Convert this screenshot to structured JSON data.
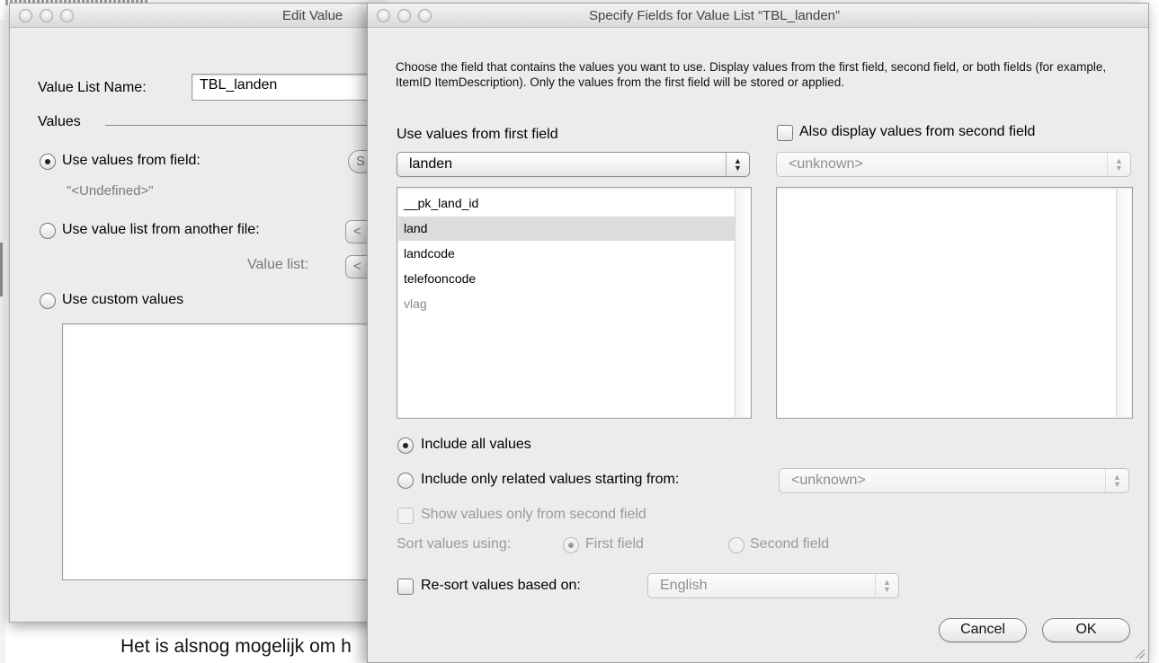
{
  "background": {
    "page_text": "Het is alsnog mogelijk om h"
  },
  "edit_window": {
    "title": "Edit Value",
    "name_label": "Value List Name:",
    "name_value": "TBL_landen",
    "values_heading": "Values",
    "options": {
      "from_field": {
        "label": "Use values from field:",
        "selected": true
      },
      "field_value": "\"<Undefined>\"",
      "from_file": {
        "label": "Use value list from another file:",
        "selected": false
      },
      "value_list_label": "Value list:",
      "custom": {
        "label": "Use custom values",
        "selected": false
      }
    },
    "specify_btn_stub": "S",
    "file_popup_stub": "<",
    "list_popup_stub": "<"
  },
  "spec_window": {
    "title": "Specify Fields for Value List “TBL_landen”",
    "description": "Choose the field that contains the values you want to use.  Display values from the first field, second field, or both fields (for example, ItemID ItemDescription). Only the values from the first field will be stored or applied.",
    "first_field": {
      "heading": "Use values from first field",
      "table": "landen",
      "fields": [
        {
          "name": "__pk_land_id",
          "selected": false,
          "enabled": true
        },
        {
          "name": "land",
          "selected": true,
          "enabled": true
        },
        {
          "name": "landcode",
          "selected": false,
          "enabled": true
        },
        {
          "name": "telefooncode",
          "selected": false,
          "enabled": true
        },
        {
          "name": "vlag",
          "selected": false,
          "enabled": false
        }
      ]
    },
    "second_field": {
      "checkbox_label": "Also display values from second field",
      "checked": false,
      "table": "<unknown>"
    },
    "include_all": {
      "label": "Include all values",
      "selected": true
    },
    "include_related": {
      "label": "Include only related values starting from:",
      "selected": false,
      "table": "<unknown>"
    },
    "show_second_only": {
      "label": "Show values only from second field",
      "checked": false,
      "enabled": false
    },
    "sort": {
      "label": "Sort values using:",
      "first": {
        "label": "First field",
        "selected": true
      },
      "second": {
        "label": "Second field",
        "selected": false
      }
    },
    "resort": {
      "label": "Re-sort values based on:",
      "checked": false,
      "language": "English"
    },
    "buttons": {
      "cancel": "Cancel",
      "ok": "OK"
    }
  }
}
